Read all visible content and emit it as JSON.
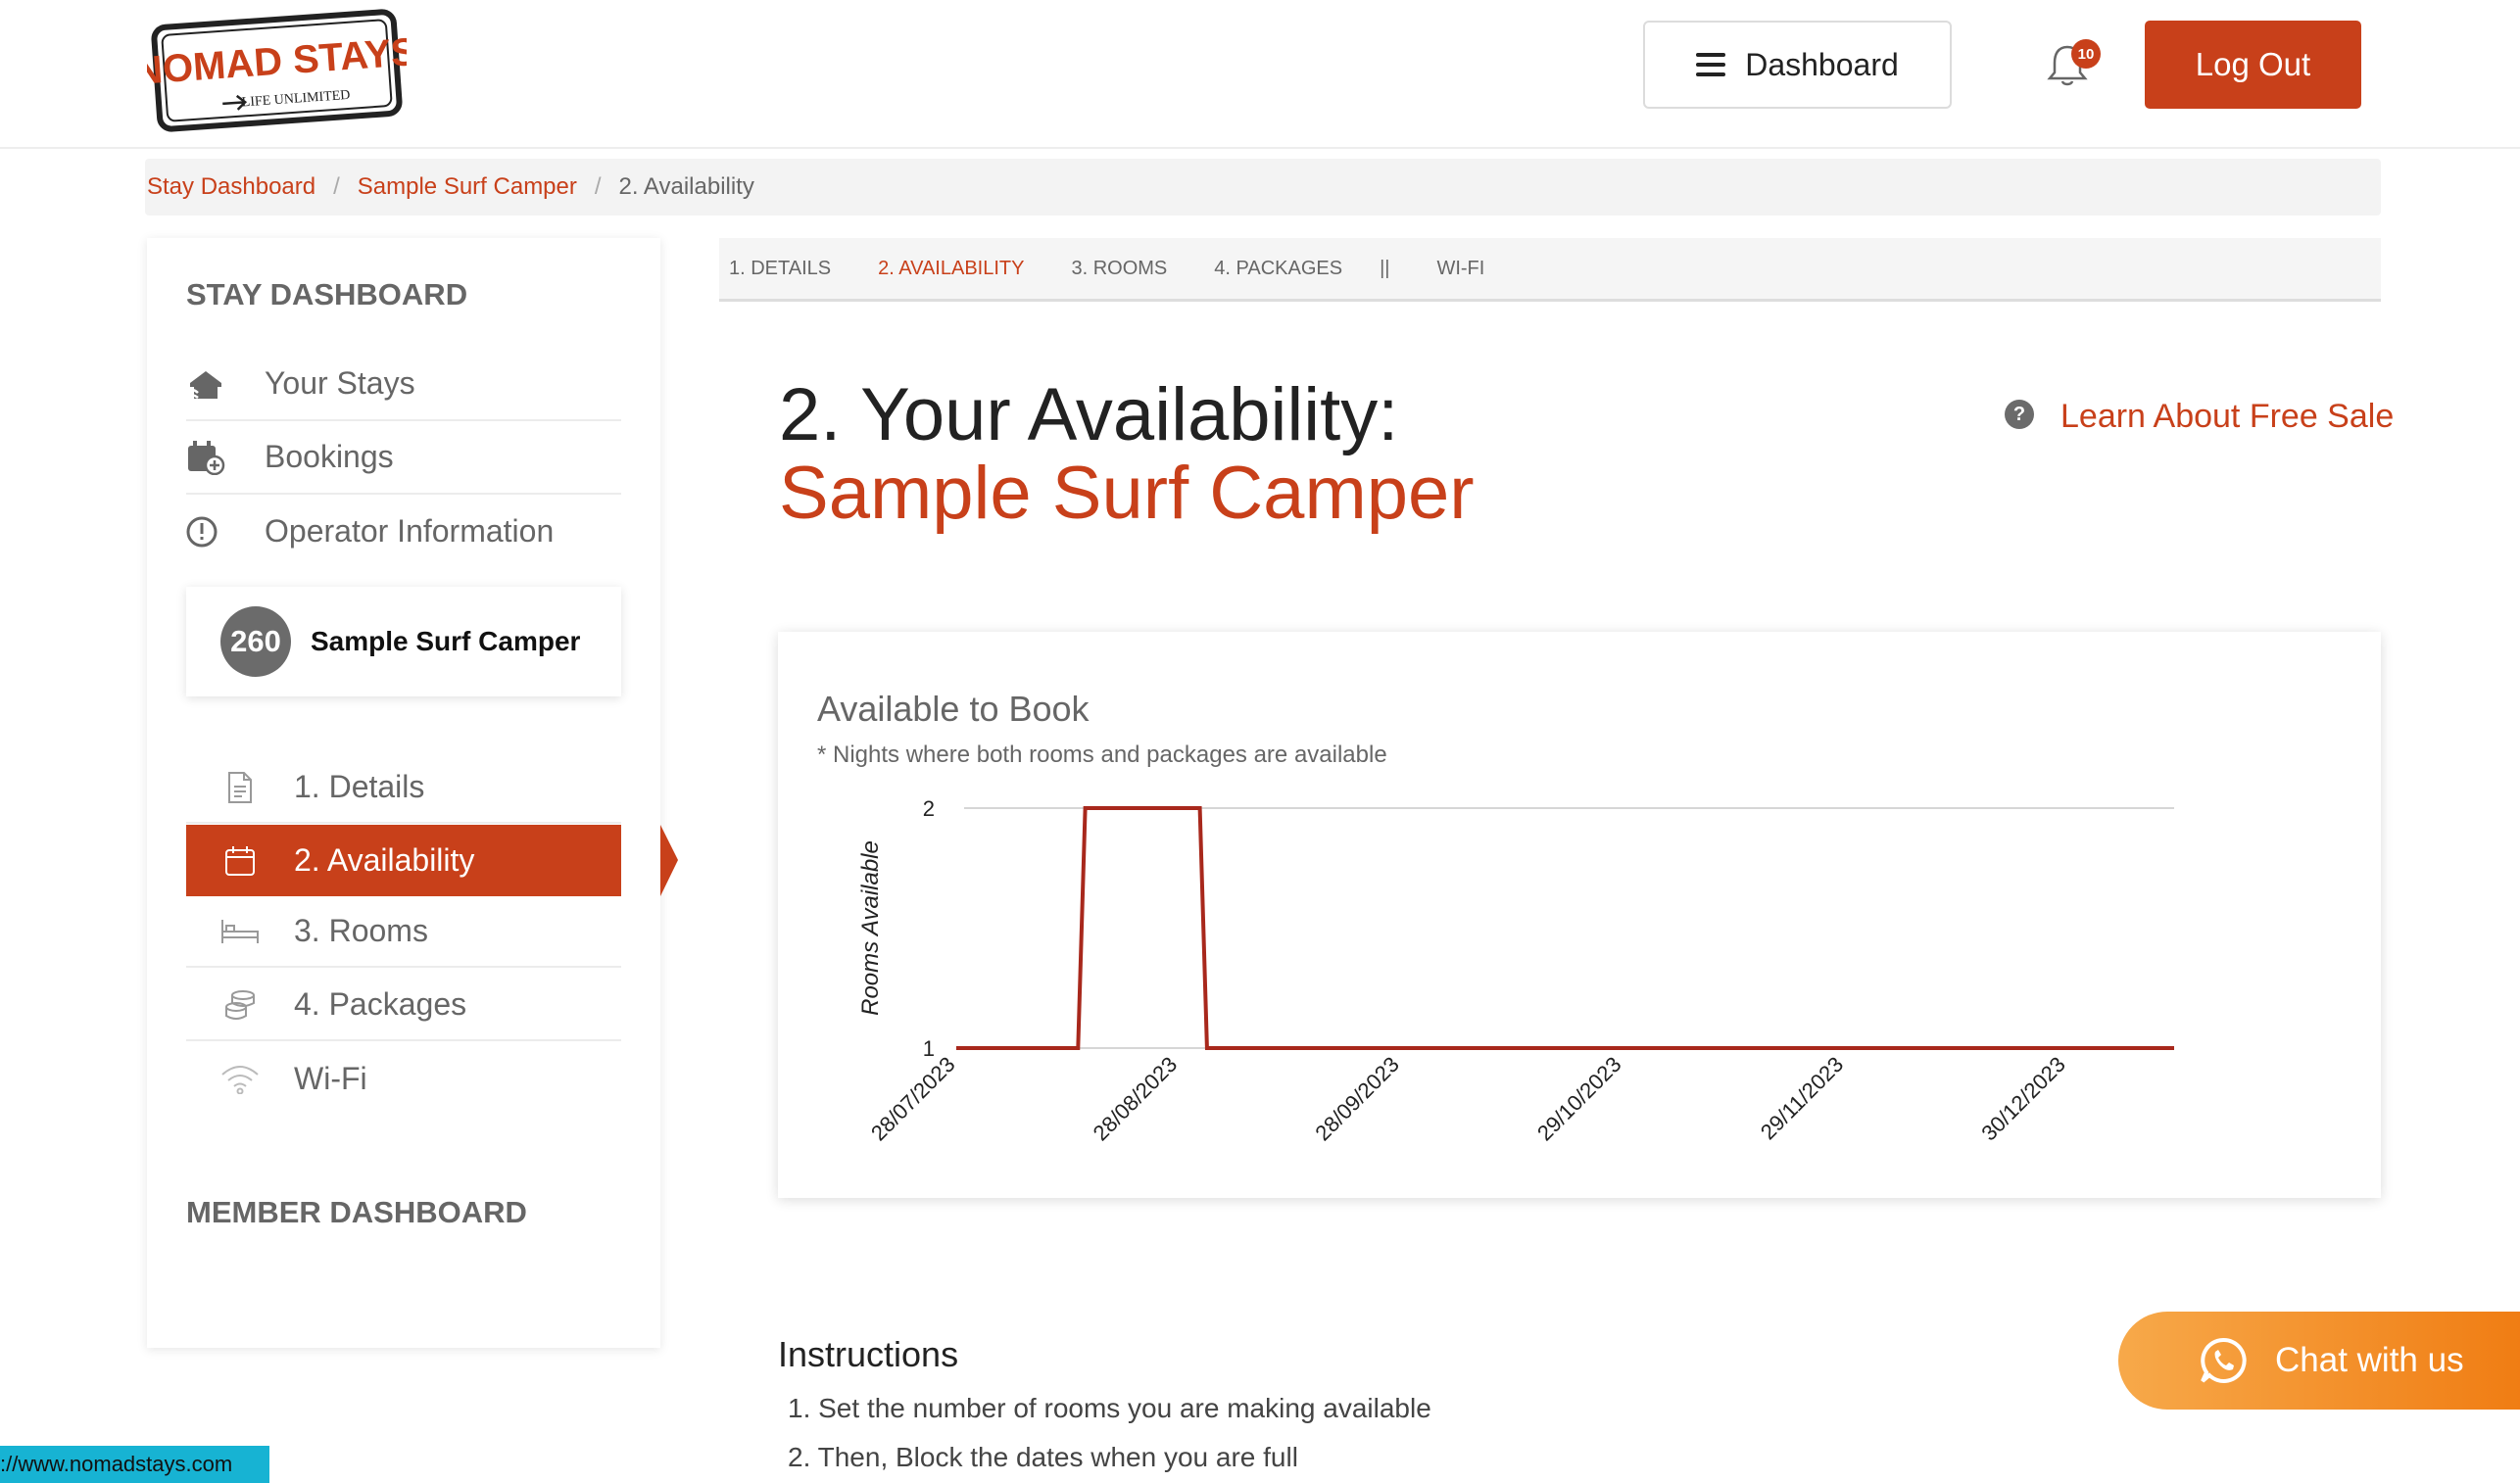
{
  "header": {
    "logo_text": "NOMAD STAYS",
    "logo_tagline": "LIFE UNLIMITED",
    "dashboard_label": "Dashboard",
    "notification_count": "10",
    "logout_label": "Log Out"
  },
  "breadcrumb": {
    "items": [
      "Stay Dashboard",
      "Sample Surf Camper"
    ],
    "current": "2. Availability",
    "separator": "/"
  },
  "sidebar": {
    "stay_heading": "STAY DASHBOARD",
    "main_items": [
      {
        "label": "Your Stays",
        "icon": "house-icon"
      },
      {
        "label": "Bookings",
        "icon": "calendar-plus-icon"
      },
      {
        "label": "Operator Information",
        "icon": "info-circle-icon"
      }
    ],
    "stay_card": {
      "number": "260",
      "name": "Sample Surf Camper"
    },
    "sub_items": [
      {
        "label": "1. Details",
        "icon": "document-icon"
      },
      {
        "label": "2. Availability",
        "icon": "calendar-icon"
      },
      {
        "label": "3. Rooms",
        "icon": "bed-icon"
      },
      {
        "label": "4. Packages",
        "icon": "coins-icon"
      },
      {
        "label": "Wi-Fi",
        "icon": "wifi-icon"
      }
    ],
    "member_heading": "MEMBER DASHBOARD"
  },
  "tabs": {
    "items": [
      "1. DETAILS",
      "2. AVAILABILITY",
      "3. ROOMS",
      "4. PACKAGES"
    ],
    "separator": "||",
    "extra": "WI-FI"
  },
  "page": {
    "title_line1": "2. Your Availability:",
    "title_line2": "Sample Surf Camper",
    "help_symbol": "?",
    "learn_link": "Learn About Free Sale"
  },
  "chart_data": {
    "type": "line",
    "title": "Available to Book",
    "subtitle": "* Nights where both rooms and packages are available",
    "ylabel": "Rooms Available",
    "xlabel": "",
    "ylim": [
      1,
      2
    ],
    "y_ticks": [
      "2",
      "1"
    ],
    "x_tick_labels": [
      "28/07/2023",
      "28/08/2023",
      "28/09/2023",
      "29/10/2023",
      "29/11/2023",
      "30/12/2023"
    ],
    "x_range": [
      "28/07/2023",
      "14/01/2024"
    ],
    "series": [
      {
        "points": [
          {
            "x": "28/07/2023",
            "y": 1
          },
          {
            "x": "14/08/2023",
            "y": 1
          },
          {
            "x": "15/08/2023",
            "y": 2
          },
          {
            "x": "31/08/2023",
            "y": 2
          },
          {
            "x": "01/09/2023",
            "y": 1
          },
          {
            "x": "14/01/2024",
            "y": 1
          }
        ],
        "color": "#a8281c"
      }
    ],
    "grid": "horizontal"
  },
  "instructions": {
    "title": "Instructions",
    "items": [
      "1. Set the number of rooms you are making available",
      "2. Then, Block the dates when you are full"
    ]
  },
  "chat": {
    "label": "Chat with us"
  },
  "status_bar": {
    "url": "://www.nomadstays.com"
  },
  "colors": {
    "accent": "#c8401a",
    "chart_line": "#a8281c",
    "chat": "#f39a2e"
  }
}
